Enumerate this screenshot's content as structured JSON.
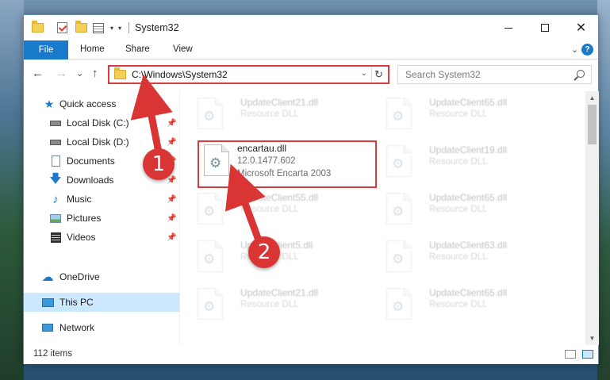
{
  "titlebar": {
    "title": "System32",
    "qa_arrow": "▾",
    "minimize_glyph": "",
    "maximize_glyph": "",
    "close_glyph": "✕"
  },
  "ribbon": {
    "tabs": [
      "File",
      "Home",
      "Share",
      "View"
    ],
    "expand_glyph": "⌄",
    "help_glyph": "?"
  },
  "navbar": {
    "back_glyph": "←",
    "forward_glyph": "→",
    "recent_glyph": "⌄",
    "up_glyph": "↑",
    "address": "C:\\Windows\\System32",
    "dropdown_glyph": "⌄",
    "refresh_glyph": "↻",
    "search_placeholder": "Search System32"
  },
  "sidebar": {
    "items": [
      {
        "label": "Quick access",
        "icon": "star-icon",
        "pinned": false
      },
      {
        "label": "Local Disk (C:)",
        "icon": "drive-icon",
        "pinned": true
      },
      {
        "label": "Local Disk (D:)",
        "icon": "drive-icon",
        "pinned": true
      },
      {
        "label": "Documents",
        "icon": "documents-icon",
        "pinned": true
      },
      {
        "label": "Downloads",
        "icon": "download-icon",
        "pinned": true
      },
      {
        "label": "Music",
        "icon": "music-icon",
        "pinned": true
      },
      {
        "label": "Pictures",
        "icon": "pictures-icon",
        "pinned": true
      },
      {
        "label": "Videos",
        "icon": "videos-icon",
        "pinned": true
      },
      {
        "label": "OneDrive",
        "icon": "cloud-icon",
        "pinned": false
      },
      {
        "label": "This PC",
        "icon": "computer-icon",
        "pinned": false,
        "selected": true
      },
      {
        "label": "Network",
        "icon": "network-icon",
        "pinned": false
      }
    ],
    "pin_glyph": "📌"
  },
  "files": {
    "highlighted": {
      "name": "encartau.dll",
      "version": "12.0.1477.602",
      "description": "Microsoft Encarta 2003"
    },
    "left_column": [
      {
        "name": "UpdateClient21.dll",
        "type": "Resource DLL"
      },
      {
        "name": "UpdateClient55.dll",
        "type": "Resource DLL"
      },
      {
        "name": "UpdateClient5.dll",
        "type": "Resource DLL"
      },
      {
        "name": "UpdateClient21.dll",
        "type": "Resource DLL"
      }
    ],
    "right_column": [
      {
        "name": "UpdateClient65.dll",
        "type": "Resource DLL"
      },
      {
        "name": "UpdateClient19.dll",
        "type": "Resource DLL"
      },
      {
        "name": "UpdateClient65.dll",
        "type": "Resource DLL"
      },
      {
        "name": "UpdateClient63.dll",
        "type": "Resource DLL"
      },
      {
        "name": "UpdateClient65.dll",
        "type": "Resource DLL"
      }
    ],
    "gear_glyph": "⚙"
  },
  "scrollbar": {
    "up_glyph": "▲",
    "down_glyph": "▼"
  },
  "status": {
    "item_count": "112 items"
  },
  "annotations": [
    {
      "number": "1"
    },
    {
      "number": "2"
    }
  ],
  "colors": {
    "accent": "#1979ca",
    "highlight_red": "#d83b3b",
    "selection": "#cce8ff"
  }
}
